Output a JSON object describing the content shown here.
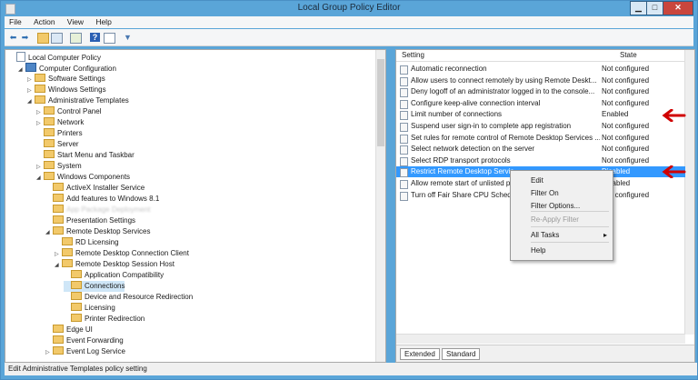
{
  "window": {
    "title": "Local Group Policy Editor",
    "controls": {
      "minimize": "▁",
      "maximize": "□",
      "close": "✕"
    }
  },
  "menu": [
    "File",
    "Action",
    "View",
    "Help"
  ],
  "toolbar": {
    "icons": [
      "back-arrow-icon",
      "forward-arrow-icon",
      "folder-up-icon",
      "show-hide-tree-icon",
      "export-list-icon",
      "help-icon",
      "properties-icon",
      "filter-icon"
    ]
  },
  "tree": [
    {
      "label": "Local Computer Policy",
      "indent": 0,
      "icon": "doc",
      "exp": ""
    },
    {
      "label": "Computer Configuration",
      "indent": 1,
      "icon": "pc",
      "exp": "◢"
    },
    {
      "label": "Software Settings",
      "indent": 2,
      "icon": "folder",
      "exp": "▷"
    },
    {
      "label": "Windows Settings",
      "indent": 2,
      "icon": "folder",
      "exp": "▷"
    },
    {
      "label": "Administrative Templates",
      "indent": 2,
      "icon": "folder",
      "exp": "◢"
    },
    {
      "label": "Control Panel",
      "indent": 3,
      "icon": "folder",
      "exp": "▷"
    },
    {
      "label": "Network",
      "indent": 3,
      "icon": "folder",
      "exp": "▷"
    },
    {
      "label": "Printers",
      "indent": 3,
      "icon": "folder",
      "exp": ""
    },
    {
      "label": "Server",
      "indent": 3,
      "icon": "folder",
      "exp": ""
    },
    {
      "label": "Start Menu and Taskbar",
      "indent": 3,
      "icon": "folder",
      "exp": ""
    },
    {
      "label": "System",
      "indent": 3,
      "icon": "folder",
      "exp": "▷"
    },
    {
      "label": "Windows Components",
      "indent": 3,
      "icon": "folder",
      "exp": "◢"
    },
    {
      "label": "ActiveX Installer Service",
      "indent": 4,
      "icon": "folder",
      "exp": ""
    },
    {
      "label": "Add features to Windows 8.1",
      "indent": 4,
      "icon": "folder",
      "exp": ""
    },
    {
      "label": "App Package Deployment",
      "indent": 4,
      "icon": "folder",
      "exp": "",
      "blur": true
    },
    {
      "label": "Presentation Settings",
      "indent": 4,
      "icon": "folder",
      "exp": ""
    },
    {
      "label": "Remote Desktop Services",
      "indent": 4,
      "icon": "folder",
      "exp": "◢"
    },
    {
      "label": "RD Licensing",
      "indent": 5,
      "icon": "folder",
      "exp": ""
    },
    {
      "label": "Remote Desktop Connection Client",
      "indent": 5,
      "icon": "folder",
      "exp": "▷"
    },
    {
      "label": "Remote Desktop Session Host",
      "indent": 5,
      "icon": "folder",
      "exp": "◢"
    },
    {
      "label": "Application Compatibility",
      "indent": 6,
      "icon": "folder",
      "exp": ""
    },
    {
      "label": "Connections",
      "indent": 6,
      "icon": "folder",
      "exp": "",
      "selected": true
    },
    {
      "label": "Device and Resource Redirection",
      "indent": 6,
      "icon": "folder",
      "exp": ""
    },
    {
      "label": "Licensing",
      "indent": 6,
      "icon": "folder",
      "exp": ""
    },
    {
      "label": "Printer Redirection",
      "indent": 6,
      "icon": "folder",
      "exp": ""
    },
    {
      "label": "Edge UI",
      "indent": 4,
      "icon": "folder",
      "exp": ""
    },
    {
      "label": "Event Forwarding",
      "indent": 4,
      "icon": "folder",
      "exp": ""
    },
    {
      "label": "Event Log Service",
      "indent": 4,
      "icon": "folder",
      "exp": "▷"
    }
  ],
  "list": {
    "columns": {
      "setting": "Setting",
      "state": "State"
    },
    "rows": [
      {
        "setting": "Automatic reconnection",
        "state": "Not configured"
      },
      {
        "setting": "Allow users to connect remotely by using Remote Deskt...",
        "state": "Not configured"
      },
      {
        "setting": "Deny logoff of an administrator logged in to the console...",
        "state": "Not configured"
      },
      {
        "setting": "Configure keep-alive connection interval",
        "state": "Not configured"
      },
      {
        "setting": "Limit number of connections",
        "state": "Enabled"
      },
      {
        "setting": "Suspend user sign-in to complete app registration",
        "state": "Not configured"
      },
      {
        "setting": "Set rules for remote control of Remote Desktop Services ...",
        "state": "Not configured"
      },
      {
        "setting": "Select network detection on the server",
        "state": "Not configured"
      },
      {
        "setting": "Select RDP transport protocols",
        "state": "Not configured"
      },
      {
        "setting": "Restrict Remote Desktop Servic",
        "state": "Disabled",
        "highlight": true
      },
      {
        "setting": "Allow remote start of unlisted p",
        "state": "Disabled"
      },
      {
        "setting": "Turn off Fair Share CPU Schedu",
        "state": "Not configured"
      }
    ]
  },
  "context_menu": {
    "items": [
      {
        "label": "Edit",
        "disabled": false
      },
      {
        "label": "Filter On",
        "disabled": false
      },
      {
        "label": "Filter Options...",
        "disabled": false
      },
      {
        "label": "Re-Apply Filter",
        "disabled": true
      },
      {
        "label": "All Tasks",
        "disabled": false,
        "submenu": "▸"
      },
      {
        "label": "Help",
        "disabled": false
      }
    ]
  },
  "tabs": {
    "extended": "Extended",
    "standard": "Standard"
  },
  "status_text": "Edit Administrative Templates policy setting",
  "colors": {
    "accent": "#3399ff",
    "arrow": "#d00000",
    "titlebar": "#5aa5d8"
  }
}
